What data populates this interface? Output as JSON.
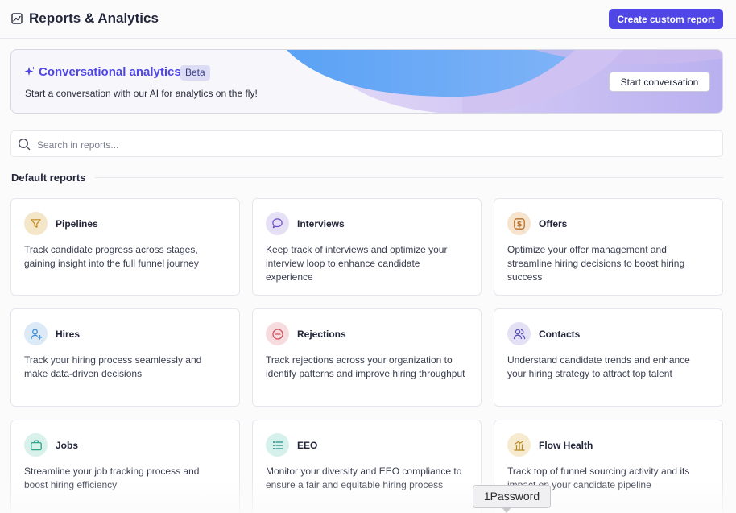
{
  "header": {
    "title": "Reports & Analytics",
    "title_icon": "trend-chart-icon",
    "create_button": "Create custom report"
  },
  "banner": {
    "heading": "Conversational analytics",
    "badge": "Beta",
    "subtitle": "Start a conversation with our AI for analytics on the fly!",
    "button": "Start conversation",
    "accent": "#4f46e5"
  },
  "search": {
    "placeholder": "Search in reports...",
    "value": ""
  },
  "section": {
    "title": "Default reports"
  },
  "reports": [
    {
      "name": "Pipelines",
      "icon": "funnel-icon",
      "desc": "Track candidate progress across stages, gaining insight into the full funnel journey",
      "color": "#f4e7c9"
    },
    {
      "name": "Interviews",
      "icon": "chat-bubble-icon",
      "desc": "Keep track of interviews and optimize your interview loop to enhance candidate experience",
      "color": "#e6e0f6"
    },
    {
      "name": "Offers",
      "icon": "dollar-coin-icon",
      "desc": "Optimize your offer management and streamline hiring decisions to boost hiring success",
      "color": "#f6e4cf"
    },
    {
      "name": "Hires",
      "icon": "user-add-icon",
      "desc": "Track your hiring process seamlessly and make data-driven decisions",
      "color": "#dce9f7"
    },
    {
      "name": "Rejections",
      "icon": "minus-circle-icon",
      "desc": "Track rejections across your organization to identify patterns and improve hiring throughput",
      "color": "#f7dcdf"
    },
    {
      "name": "Contacts",
      "icon": "users-icon",
      "desc": "Understand candidate trends and enhance your hiring strategy to attract top talent",
      "color": "#e4e1f5"
    },
    {
      "name": "Jobs",
      "icon": "briefcase-icon",
      "desc": "Streamline your job tracking process and boost hiring efficiency",
      "color": "#d8f1ea"
    },
    {
      "name": "EEO",
      "icon": "list-icon",
      "desc": "Monitor your diversity and EEO compliance to ensure a fair and equitable hiring process",
      "color": "#d6f0ec"
    },
    {
      "name": "Flow Health",
      "icon": "bar-chart-icon",
      "desc": "Track top of funnel sourcing activity and its impact on your candidate pipeline",
      "color": "#f6ebcf"
    }
  ],
  "tooltip": {
    "text": "1Password"
  }
}
